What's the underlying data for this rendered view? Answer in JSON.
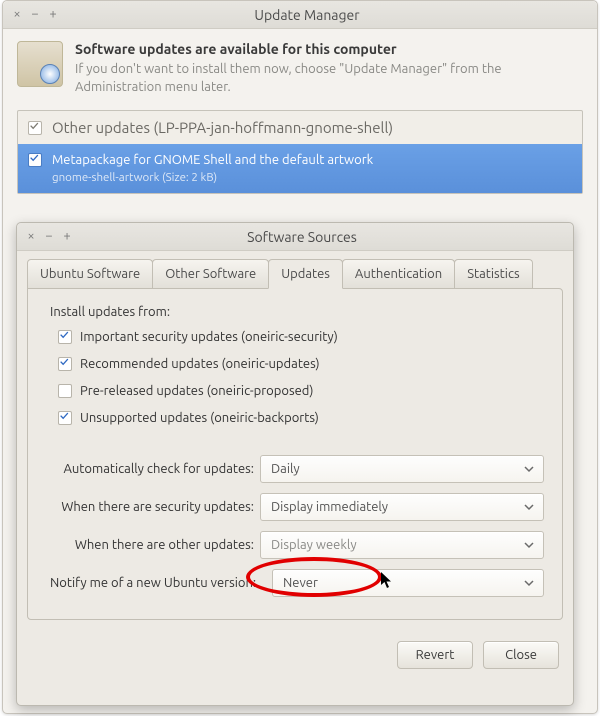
{
  "update_manager": {
    "title": "Update Manager",
    "heading": "Software updates are available for this computer",
    "subtext": "If you don't want to install them now, choose \"Update Manager\" from the Administration menu later.",
    "group_title": "Other updates (LP-PPA-jan-hoffmann-gnome-shell)",
    "item_desc": "Metapackage for GNOME Shell and the default artwork",
    "item_sub": "gnome-shell-artwork (Size: 2 kB)"
  },
  "software_sources": {
    "title": "Software Sources",
    "tabs": [
      "Ubuntu Software",
      "Other Software",
      "Updates",
      "Authentication",
      "Statistics"
    ],
    "active_tab_index": 2,
    "install_from_label": "Install updates from:",
    "checkboxes": [
      {
        "label": "Important security updates (oneiric-security)",
        "checked": true
      },
      {
        "label": "Recommended updates (oneiric-updates)",
        "checked": true
      },
      {
        "label": "Pre-released updates (oneiric-proposed)",
        "checked": false
      },
      {
        "label": "Unsupported updates (oneiric-backports)",
        "checked": true
      }
    ],
    "rows": [
      {
        "label": "Automatically check for updates:",
        "value": "Daily"
      },
      {
        "label": "When there are security updates:",
        "value": "Display immediately"
      },
      {
        "label": "When there are other updates:",
        "value": "Display weekly"
      },
      {
        "label": "Notify me of a new Ubuntu version:",
        "value": "Never"
      }
    ],
    "buttons": {
      "revert": "Revert",
      "close": "Close"
    }
  }
}
